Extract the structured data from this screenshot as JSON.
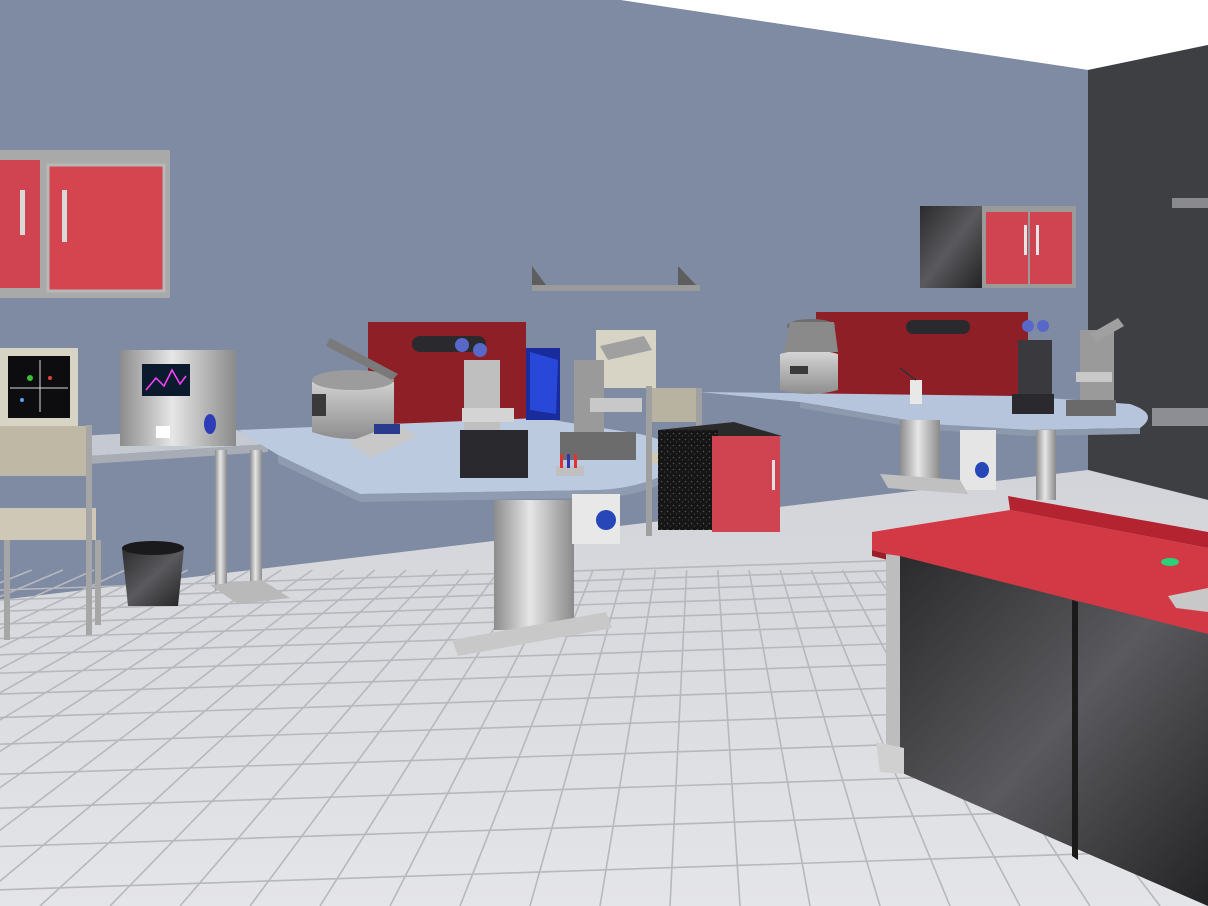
{
  "scene": {
    "kind": "3d-laboratory-viewport",
    "colors": {
      "wall": "#7f8aa3",
      "ceiling": "#ffffff",
      "dark_wall": "#3e3f43",
      "floor": "#d9dade",
      "floor_grout": "#b9bbc0",
      "bench_top": "#b9c6dc",
      "cabinet_red": "#cf4450",
      "panel_dark_red": "#8e1f27",
      "steel": "#b3b3b3",
      "steel_dark": "#6a6a6a",
      "instrument_black": "#2a2a2e"
    },
    "objects": [
      {
        "name": "wall-cabinet-left",
        "icon": "cabinet-icon"
      },
      {
        "name": "wall-cabinet-right",
        "icon": "cabinet-icon"
      },
      {
        "name": "wall-shelf",
        "icon": "shelf-icon"
      },
      {
        "name": "computer-monitor",
        "icon": "monitor-icon"
      },
      {
        "name": "flow-cytometer",
        "icon": "analyzer-icon"
      },
      {
        "name": "centrifuge-left",
        "icon": "centrifuge-icon"
      },
      {
        "name": "centrifuge-right",
        "icon": "centrifuge-icon"
      },
      {
        "name": "microscope-1",
        "icon": "microscope-icon"
      },
      {
        "name": "microscope-2",
        "icon": "microscope-icon"
      },
      {
        "name": "microscope-3",
        "icon": "microscope-icon"
      },
      {
        "name": "microscope-4",
        "icon": "microscope-icon"
      },
      {
        "name": "waste-bin",
        "icon": "bin-icon"
      },
      {
        "name": "sink-counter",
        "icon": "counter-icon"
      }
    ]
  }
}
